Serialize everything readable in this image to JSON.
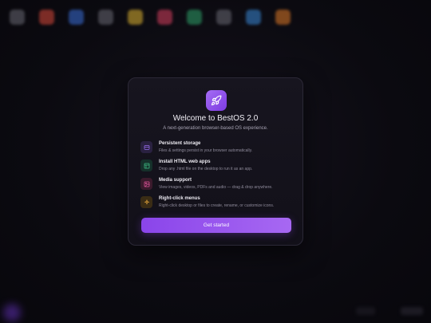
{
  "colors": {
    "accent": "#8a45ea",
    "storage": "#7b4fd6",
    "html": "#2f9e6b",
    "media": "#d8418c",
    "menus": "#d99a2e"
  },
  "desktop_icons": [
    "#6a6a74",
    "#d9493b",
    "#3b6fd9",
    "#6a6a74",
    "#e0b532",
    "#d94060",
    "#2fa36a",
    "#6a6a74",
    "#3a8ad8",
    "#e07a28"
  ],
  "welcome": {
    "logo_icon": "rocket-icon",
    "title": "Welcome to BestOS 2.0",
    "subtitle": "A next-generation browser-based OS experience.",
    "features": [
      {
        "icon": "storage-icon",
        "title": "Persistent storage",
        "desc": "Files & settings persist in your browser automatically."
      },
      {
        "icon": "layout-icon",
        "title": "Install HTML web apps",
        "desc": "Drop any .html file on the desktop to run it as an app."
      },
      {
        "icon": "image-icon",
        "title": "Media support",
        "desc": "View images, videos, PDFs and audio — drag & drop anywhere."
      },
      {
        "icon": "sparkle-icon",
        "title": "Right-click menus",
        "desc": "Right-click desktop or files to create, rename, or customize icons."
      }
    ],
    "cta_label": "Get started"
  }
}
